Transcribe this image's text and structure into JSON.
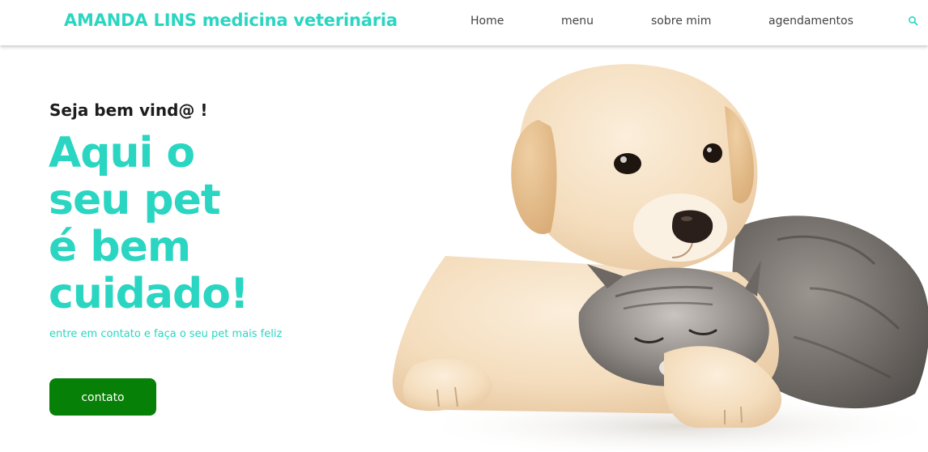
{
  "brand": {
    "title": "AMANDA LINS medicina veterinária"
  },
  "nav": {
    "items": [
      {
        "label": "Home"
      },
      {
        "label": "menu"
      },
      {
        "label": "sobre mim"
      },
      {
        "label": "agendamentos"
      }
    ],
    "search_icon": "search-icon"
  },
  "hero": {
    "greeting": "Seja bem vind@ !",
    "headline_lines": [
      "Aqui o",
      "seu pet",
      "é bem",
      "cuidado!"
    ],
    "subtitle": "entre em contato e faça o seu pet mais feliz",
    "cta_label": "contato",
    "image": "puppy-and-kitten-photo"
  },
  "colors": {
    "accent": "#2ad6c1",
    "cta_background": "#078007",
    "nav_text": "#444444",
    "greeting_text": "#1d1d1d"
  }
}
